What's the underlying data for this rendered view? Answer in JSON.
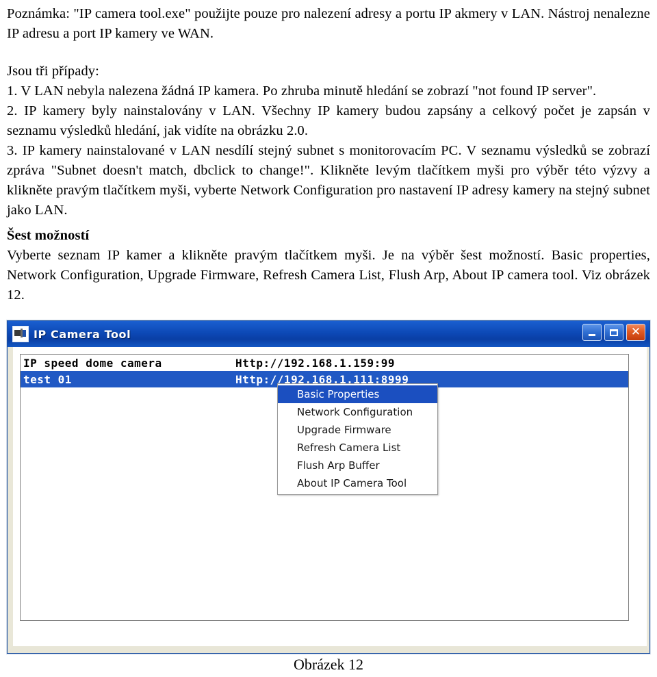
{
  "document": {
    "paragraphs": [
      {
        "id": "note",
        "bold": false,
        "text": "Poznámka: \"IP camera tool.exe\" použijte pouze pro nalezení adresy a portu IP akmery v LAN. Nástroj nenalezne IP adresu a port IP kamery ve WAN."
      },
      {
        "id": "cases-intro",
        "bold": false,
        "text": "Jsou tři případy:"
      },
      {
        "id": "case-1",
        "bold": false,
        "text": "1. V LAN nebyla nalezena žádná IP kamera. Po zhruba minutě hledání se zobrazí \"not found IP server\"."
      },
      {
        "id": "case-2",
        "bold": false,
        "text": "2. IP kamery byly nainstalovány v LAN. Všechny IP kamery budou zapsány a celkový počet je zapsán v seznamu výsledků hledání, jak vidíte na obrázku 2.0."
      },
      {
        "id": "case-3",
        "bold": false,
        "text": "3. IP kamery nainstalované v LAN nesdílí stejný subnet s monitorovacím PC. V seznamu výsledků se zobrazí zpráva \"Subnet doesn't match, dbclick to change!\". Klikněte levým tlačítkem myši pro výběr této výzvy a klikněte pravým tlačítkem myši, vyberte Network Configuration pro nastavení IP adresy kamery na stejný subnet jako LAN."
      },
      {
        "id": "six-options-heading",
        "bold": true,
        "text": "Šest možností"
      },
      {
        "id": "six-options-body",
        "bold": false,
        "text": "Vyberte seznam IP kamer a klikněte pravým tlačítkem myši. Je na výběr šest možností. Basic properties, Network Configuration, Upgrade Firmware, Refresh Camera List, Flush Arp, About IP camera tool. Viz obrázek 12."
      }
    ],
    "figure_caption": "Obrázek 12"
  },
  "app_window": {
    "title": "IP Camera Tool",
    "title_icon": "camera-icon",
    "window_buttons": [
      {
        "name": "minimize",
        "label": "_"
      },
      {
        "name": "maximize",
        "label": "□"
      },
      {
        "name": "close",
        "label": "✕"
      }
    ],
    "camera_list": {
      "rows": [
        {
          "name": "IP speed dome camera",
          "url": "Http://192.168.1.159:99",
          "selected": false
        },
        {
          "name": "test 01",
          "url": "Http://192.168.1.111:8999",
          "selected": true
        }
      ]
    },
    "context_menu": {
      "items": [
        {
          "label": "Basic Properties",
          "highlighted": true
        },
        {
          "label": "Network Configuration",
          "highlighted": false
        },
        {
          "label": "Upgrade Firmware",
          "highlighted": false
        },
        {
          "label": "Refresh Camera List",
          "highlighted": false
        },
        {
          "label": "Flush Arp Buffer",
          "highlighted": false
        },
        {
          "label": "About IP Camera Tool",
          "highlighted": false
        }
      ]
    }
  },
  "colors": {
    "titlebar_blue": "#0d49b6",
    "selection_blue": "#2159c4",
    "menu_highlight": "#1b4fc0",
    "close_red": "#e05a22",
    "window_chrome": "#e9e7d8"
  }
}
